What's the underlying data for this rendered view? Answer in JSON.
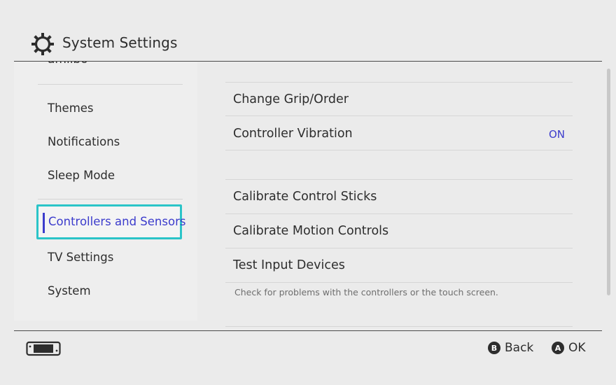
{
  "header": {
    "title": "System Settings",
    "icon": "gear-icon"
  },
  "sidebar": {
    "partial_item": "amiibo",
    "items": [
      {
        "label": "Themes"
      },
      {
        "label": "Notifications"
      },
      {
        "label": "Sleep Mode"
      },
      {
        "label": "Controllers and Sensors",
        "selected": true
      },
      {
        "label": "TV Settings"
      },
      {
        "label": "System"
      }
    ]
  },
  "main": {
    "rows": [
      {
        "label": "Change Grip/Order",
        "value": ""
      },
      {
        "label": "Controller Vibration",
        "value": "ON"
      },
      {
        "label": "Calibrate Control Sticks",
        "value": ""
      },
      {
        "label": "Calibrate Motion Controls",
        "value": ""
      },
      {
        "label": "Test Input Devices",
        "value": ""
      }
    ],
    "description": "Check for problems with the controllers or the touch screen."
  },
  "footer": {
    "console_icon": "console-icon",
    "back": {
      "button": "B",
      "label": "Back"
    },
    "ok": {
      "button": "A",
      "label": "OK"
    }
  },
  "colors": {
    "background": "#ebebeb",
    "accent_blue": "#3c3ccc",
    "focus_cyan": "#2bc4c8",
    "text": "#2d2d2d"
  }
}
